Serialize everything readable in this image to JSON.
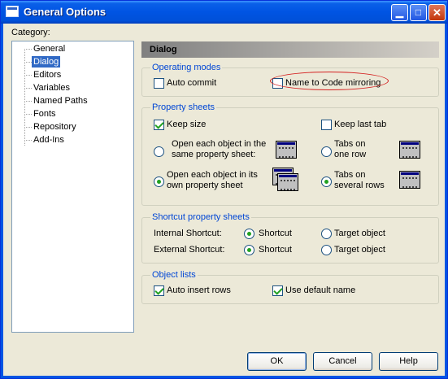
{
  "window": {
    "title": "General Options"
  },
  "category": {
    "label": "Category:",
    "items": [
      {
        "label": "General",
        "selected": false
      },
      {
        "label": "Dialog",
        "selected": true
      },
      {
        "label": "Editors",
        "selected": false
      },
      {
        "label": "Variables",
        "selected": false
      },
      {
        "label": "Named Paths",
        "selected": false
      },
      {
        "label": "Fonts",
        "selected": false
      },
      {
        "label": "Repository",
        "selected": false
      },
      {
        "label": "Add-Ins",
        "selected": false
      }
    ]
  },
  "panel": {
    "title": "Dialog"
  },
  "operating_modes": {
    "title": "Operating modes",
    "auto_commit": {
      "label": "Auto commit",
      "checked": false
    },
    "name_to_code": {
      "label": "Name to Code mirroring",
      "checked": false
    }
  },
  "property_sheets": {
    "title": "Property sheets",
    "keep_size": {
      "label": "Keep size",
      "checked": true
    },
    "keep_last_tab": {
      "label": "Keep last tab",
      "checked": false
    },
    "open_same_line1": "Open each object in the",
    "open_same_line2": "same property sheet:",
    "open_own_line1": "Open each object in its",
    "open_own_line2": "own property sheet",
    "tabs_one_line1": "Tabs on",
    "tabs_one_line2": "one row",
    "tabs_several_line1": "Tabs on",
    "tabs_several_line2": "several rows",
    "open_mode": "own",
    "tabs_mode": "several"
  },
  "shortcut_sheets": {
    "title": "Shortcut property sheets",
    "internal_label": "Internal Shortcut:",
    "external_label": "External Shortcut:",
    "shortcut_option": "Shortcut",
    "target_option": "Target object",
    "internal_value": "Shortcut",
    "external_value": "Shortcut"
  },
  "object_lists": {
    "title": "Object lists",
    "auto_insert_rows": {
      "label": "Auto insert rows",
      "checked": true
    },
    "use_default_name": {
      "label": "Use default name",
      "checked": true
    }
  },
  "buttons": {
    "ok": "OK",
    "cancel": "Cancel",
    "help": "Help"
  },
  "icons": {
    "title": "window-icon",
    "minimize": "minimize-icon",
    "maximize": "maximize-icon",
    "close": "close-icon",
    "same_sheet": "single-window-icon",
    "own_sheet": "stacked-windows-icon",
    "one_row": "tabs-one-row-icon",
    "several_rows": "tabs-several-rows-icon"
  },
  "colors": {
    "title_bar": "#0054e3",
    "selection": "#316ac5",
    "group_label": "#0046d5",
    "annotation": "#d42020"
  }
}
